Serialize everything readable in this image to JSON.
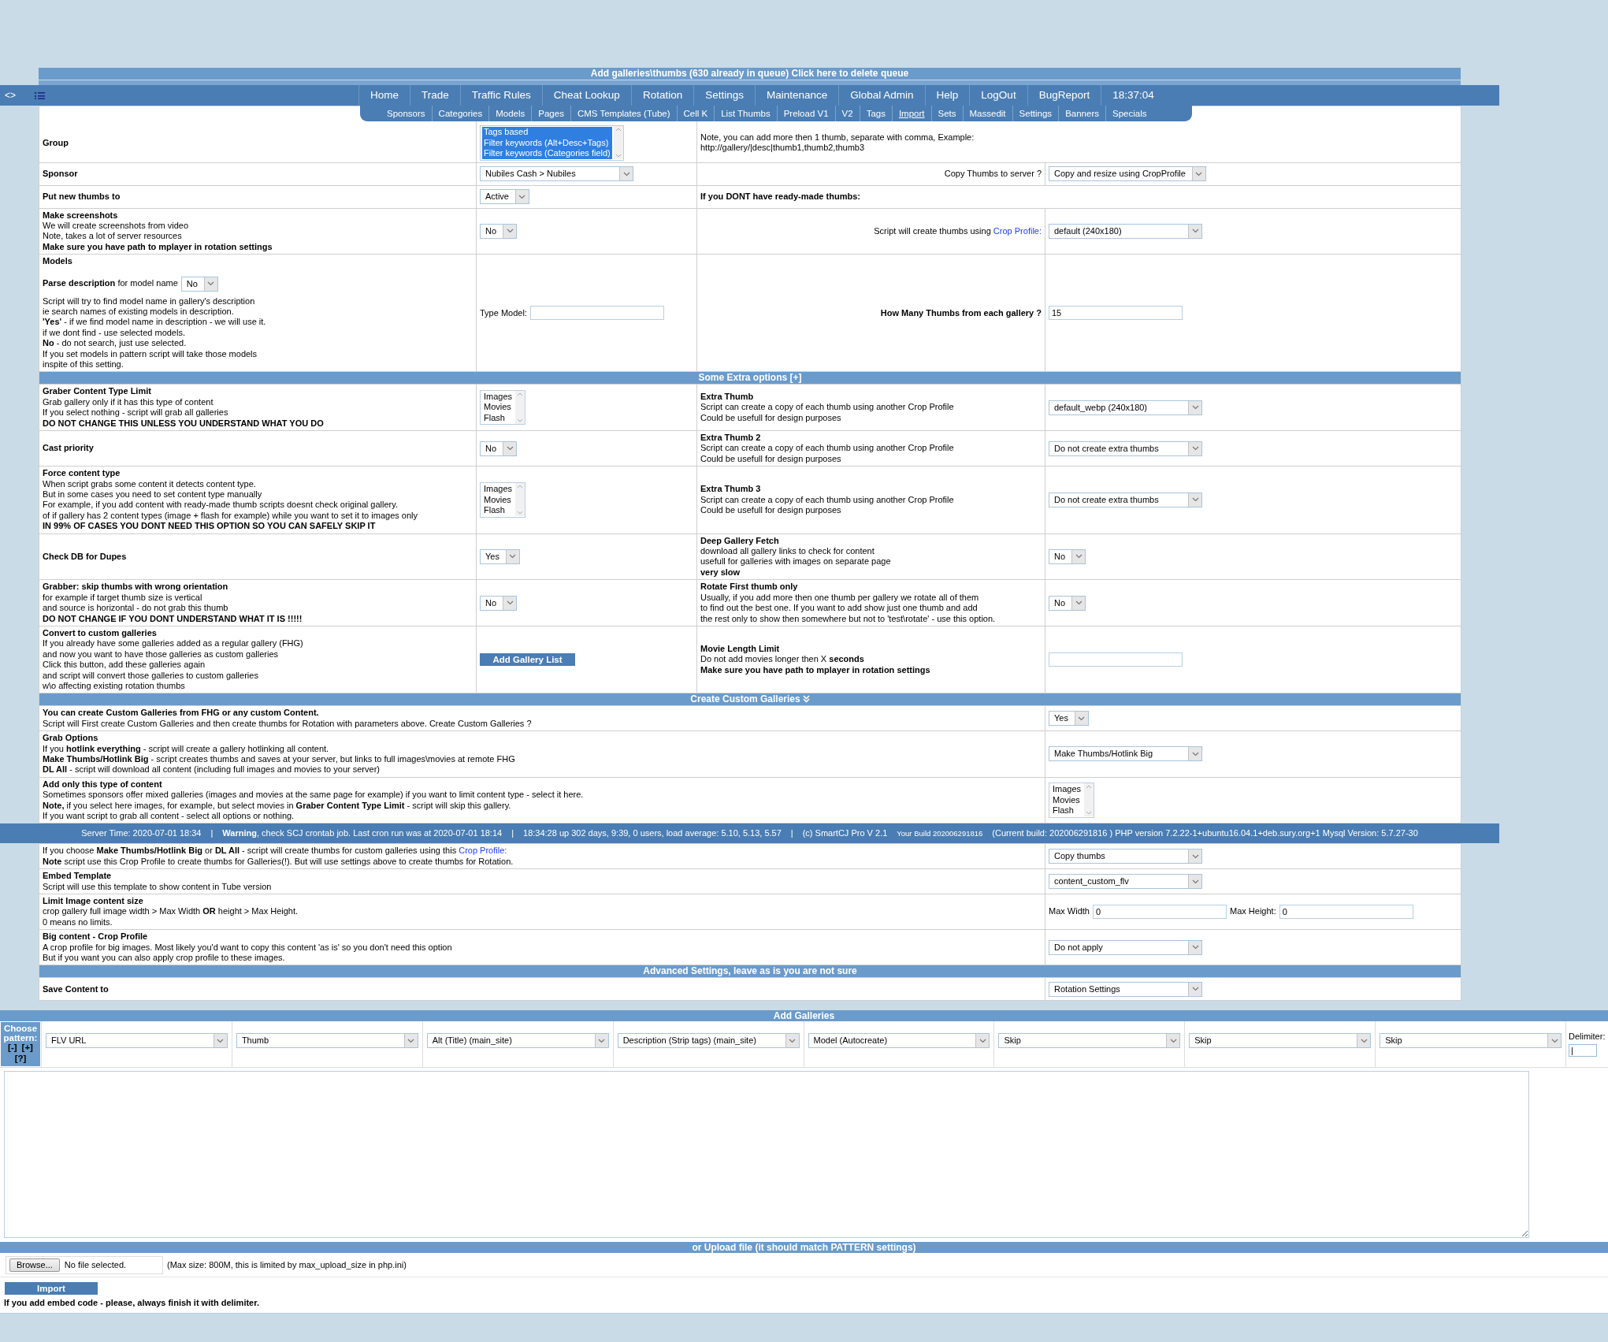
{
  "title_bar": {
    "text": "Add galleries\\thumbs (630 already in queue) Click here to delete queue"
  },
  "nav": {
    "toggle": "<>",
    "items": [
      {
        "label": "Home"
      },
      {
        "label": "Trade"
      },
      {
        "label": "Traffic Rules"
      },
      {
        "label": "Cheat Lookup"
      },
      {
        "label": "Rotation"
      },
      {
        "label": "Settings"
      },
      {
        "label": "Maintenance"
      },
      {
        "label": "Global Admin"
      },
      {
        "label": "Help"
      },
      {
        "label": "LogOut"
      },
      {
        "label": "BugReport"
      }
    ],
    "clock": "18:37:04"
  },
  "subnav": [
    {
      "label": "Sponsors",
      "selected": false
    },
    {
      "label": "Categories",
      "selected": false
    },
    {
      "label": "Models",
      "selected": false
    },
    {
      "label": "Pages",
      "selected": false
    },
    {
      "label": "CMS Templates (Tube)",
      "selected": false
    },
    {
      "label": "Cell K",
      "selected": false
    },
    {
      "label": "List Thumbs",
      "selected": false
    },
    {
      "label": "Preload V1",
      "selected": false
    },
    {
      "label": "V2",
      "selected": false
    },
    {
      "label": "Tags",
      "selected": false
    },
    {
      "label": "Import",
      "selected": true
    },
    {
      "label": "Sets",
      "selected": false
    },
    {
      "label": "Massedit",
      "selected": false
    },
    {
      "label": "Settings",
      "selected": false
    },
    {
      "label": "Banners",
      "selected": false
    },
    {
      "label": "Specials",
      "selected": false
    }
  ],
  "main_table": {
    "rows": [
      {
        "kind": "split",
        "cells": [
          [
            {
              "kind": "title",
              "text": "Group"
            }
          ],
          [
            {
              "kind": "listbox",
              "options": [
                {
                  "label": "Tags based",
                  "selected": true
                },
                {
                  "label": "Filter keywords (Alt+Desc+Tags)",
                  "selected": true
                },
                {
                  "label": "Filter keywords (Categories field)",
                  "selected": true
                }
              ]
            }
          ],
          [
            {
              "kind": "text",
              "text": "Note, you can add more then 1 thumb, separate with comma, Example:"
            },
            {
              "kind": "text",
              "text": "http://gallery/|desc|thumb1,thumb2,thumb3"
            }
          ]
        ]
      },
      {
        "kind": "four",
        "cells": [
          [
            {
              "kind": "title",
              "text": "Sponsor"
            }
          ],
          [
            {
              "kind": "select",
              "value": "Nubiles Cash > Nubiles"
            }
          ],
          [
            {
              "kind": "prompt",
              "text": "Copy Thumbs to server ?"
            }
          ],
          [
            {
              "kind": "select",
              "value": "Copy and resize using CropProfile"
            }
          ]
        ]
      },
      {
        "kind": "split",
        "cells": [
          [
            {
              "kind": "title",
              "text": "Put new thumbs to"
            }
          ],
          [
            {
              "kind": "select",
              "value": "Active"
            }
          ],
          [
            {
              "kind": "title",
              "text": "If you DONT have ready-made thumbs:"
            }
          ]
        ]
      },
      {
        "kind": "four",
        "cells": [
          [
            {
              "kind": "title",
              "text": "Make screenshots"
            },
            {
              "kind": "text",
              "text": "We will create screenshots from video"
            },
            {
              "kind": "text",
              "text": "Note, takes a lot of server resources"
            },
            {
              "kind": "title",
              "text": "Make sure you have path to mplayer in rotation settings"
            }
          ],
          [
            {
              "kind": "select",
              "value": "No"
            }
          ],
          [
            {
              "kind": "prompt",
              "text": "Script will create thumbs using",
              "link": "Crop Profile:"
            }
          ],
          [
            {
              "kind": "select",
              "value": "default (240x180)"
            }
          ]
        ]
      },
      {
        "kind": "four",
        "cells": [
          [
            {
              "kind": "title",
              "text": "Models"
            },
            {
              "kind": "inline-select",
              "text": "**Parse description** for model name",
              "value": "No"
            },
            {
              "kind": "text",
              "text": "Script will try to find model name in gallery's description"
            },
            {
              "kind": "text",
              "text": "ie search names of existing models in description."
            },
            {
              "kind": "text",
              "text": "**'Yes'** - if we find model name in description - we will use it."
            },
            {
              "kind": "text",
              "text": "if we dont find - use selected models."
            },
            {
              "kind": "text",
              "text": "**No** - do not search, just use selected."
            },
            {
              "kind": "text",
              "text": "If you set models in pattern script will take those models"
            },
            {
              "kind": "text",
              "text": "inspite of this setting."
            }
          ],
          [
            {
              "kind": "input",
              "label": "Type Model:"
            }
          ],
          [
            {
              "kind": "prompt",
              "text": "How Many Thumbs from each gallery ?",
              "bold": true
            }
          ],
          [
            {
              "kind": "input",
              "value": "15"
            }
          ]
        ]
      },
      {
        "kind": "section",
        "text": "Some Extra options [+]"
      },
      {
        "kind": "four",
        "cells": [
          [
            {
              "kind": "title",
              "text": "Graber Content Type Limit"
            },
            {
              "kind": "text",
              "text": "Grab gallery only if it has this type of content"
            },
            {
              "kind": "text",
              "text": "If you select nothing - script will grab all galleries"
            },
            {
              "kind": "title",
              "text": "DO NOT CHANGE THIS UNLESS YOU UNDERSTAND WHAT YOU DO"
            }
          ],
          [
            {
              "kind": "listbox",
              "options": [
                {
                  "label": "Images",
                  "selected": false
                },
                {
                  "label": "Movies",
                  "selected": false
                },
                {
                  "label": "Flash",
                  "selected": false
                }
              ]
            }
          ],
          [
            {
              "kind": "title",
              "text": "Extra Thumb"
            },
            {
              "kind": "text",
              "text": "Script can create a copy of each thumb using another Crop Profile"
            },
            {
              "kind": "text",
              "text": "Could be usefull for design purposes"
            }
          ],
          [
            {
              "kind": "select",
              "value": "default_webp (240x180)"
            }
          ]
        ]
      },
      {
        "kind": "four",
        "cells": [
          [
            {
              "kind": "title",
              "text": "Cast priority"
            }
          ],
          [
            {
              "kind": "select",
              "value": "No"
            }
          ],
          [
            {
              "kind": "title",
              "text": "Extra Thumb 2"
            },
            {
              "kind": "text",
              "text": "Script can create a copy of each thumb using another Crop Profile"
            },
            {
              "kind": "text",
              "text": "Could be usefull for design purposes"
            }
          ],
          [
            {
              "kind": "select",
              "value": "Do not create extra thumbs"
            }
          ]
        ]
      },
      {
        "kind": "four",
        "cells": [
          [
            {
              "kind": "title",
              "text": "Force content type"
            },
            {
              "kind": "text",
              "text": "When script grabs some content it detects content type."
            },
            {
              "kind": "text",
              "text": "But in some cases you need to set content type manually"
            },
            {
              "kind": "text",
              "text": "For example, if you add content with ready-made thumb scripts doesnt check original gallery."
            },
            {
              "kind": "text",
              "text": "of if gallery has 2 content types (image + flash for example) while you want to set it to images only"
            },
            {
              "kind": "title",
              "text": "IN 99% OF CASES YOU DONT NEED THIS OPTION SO YOU CAN SAFELY SKIP IT"
            }
          ],
          [
            {
              "kind": "listbox",
              "options": [
                {
                  "label": "Images",
                  "selected": false
                },
                {
                  "label": "Movies",
                  "selected": false
                },
                {
                  "label": "Flash",
                  "selected": false
                }
              ]
            }
          ],
          [
            {
              "kind": "title",
              "text": "Extra Thumb 3"
            },
            {
              "kind": "text",
              "text": "Script can create a copy of each thumb using another Crop Profile"
            },
            {
              "kind": "text",
              "text": "Could be usefull for design purposes"
            }
          ],
          [
            {
              "kind": "select",
              "value": "Do not create extra thumbs"
            }
          ]
        ]
      },
      {
        "kind": "four",
        "cells": [
          [
            {
              "kind": "title",
              "text": "Check DB for Dupes"
            }
          ],
          [
            {
              "kind": "select",
              "value": "Yes"
            }
          ],
          [
            {
              "kind": "title",
              "text": "Deep Gallery Fetch"
            },
            {
              "kind": "text",
              "text": "download all gallery links to check for content"
            },
            {
              "kind": "text",
              "text": "usefull for galleries with images on separate page"
            },
            {
              "kind": "title",
              "text": "very slow"
            }
          ],
          [
            {
              "kind": "select",
              "value": "No"
            }
          ]
        ]
      },
      {
        "kind": "four",
        "cells": [
          [
            {
              "kind": "title",
              "text": "Grabber: skip thumbs with wrong orientation"
            },
            {
              "kind": "text",
              "text": "for example if target thumb size is vertical"
            },
            {
              "kind": "text",
              "text": "and source is horizontal - do not grab this thumb"
            },
            {
              "kind": "title",
              "text": "DO NOT CHANGE IF YOU DONT UNDERSTAND WHAT IT IS !!!!!"
            }
          ],
          [
            {
              "kind": "select",
              "value": "No"
            }
          ],
          [
            {
              "kind": "title",
              "text": "Rotate First thumb only"
            },
            {
              "kind": "text",
              "text": "Usually, if you add more then one thumb per gallery we rotate all of them"
            },
            {
              "kind": "text",
              "text": "to find out the best one. If you want to add show just one thumb and add"
            },
            {
              "kind": "text",
              "text": "the rest only to show then somewhere but not to 'test\\rotate' - use this option."
            }
          ],
          [
            {
              "kind": "select",
              "value": "No"
            }
          ]
        ]
      },
      {
        "kind": "four",
        "cells": [
          [
            {
              "kind": "title",
              "text": "Convert to custom galleries"
            },
            {
              "kind": "text",
              "text": "If you already have some galleries added as a regular gallery (FHG)"
            },
            {
              "kind": "text",
              "text": "and now you want to have those galleries as custom galleries"
            },
            {
              "kind": "text",
              "text": "Click this button, add these galleries again"
            },
            {
              "kind": "text",
              "text": "and script will convert those galleries to custom galleries"
            },
            {
              "kind": "text",
              "text": "w\\o affecting existing rotation thumbs"
            }
          ],
          [
            {
              "kind": "button",
              "label": "Add Gallery List"
            }
          ],
          [
            {
              "kind": "title",
              "text": "Movie Length Limit"
            },
            {
              "kind": "text",
              "text": "Do not add movies longer then X **seconds**"
            },
            {
              "kind": "title",
              "text": "Make sure you have path to mplayer in rotation settings"
            }
          ],
          [
            {
              "kind": "input"
            }
          ]
        ]
      },
      {
        "kind": "section-toggle",
        "text": "Create Custom Galleries"
      },
      {
        "kind": "wide",
        "cells": [
          [
            {
              "kind": "title",
              "text": "You can create Custom Galleries from FHG or any custom Content."
            },
            {
              "kind": "text",
              "text": "Script will First create Custom Galleries and then create thumbs for Rotation with parameters above. Create Custom Galleries ?"
            }
          ],
          [
            {
              "kind": "select",
              "value": "Yes"
            }
          ]
        ]
      },
      {
        "kind": "wide",
        "cells": [
          [
            {
              "kind": "title",
              "text": "Grab Options"
            },
            {
              "kind": "text",
              "text": "If you **hotlink everything** - script will create a gallery hotlinking all content."
            },
            {
              "kind": "text",
              "text": "**Make Thumbs/Hotlink Big** - script creates thumbs and saves at your server, but links to full images\\movies at remote FHG"
            },
            {
              "kind": "text",
              "text": "**DL All** - script will download all content (including full images and movies to your server)"
            }
          ],
          [
            {
              "kind": "select",
              "value": "Make Thumbs/Hotlink Big"
            }
          ]
        ]
      },
      {
        "kind": "wide",
        "cells": [
          [
            {
              "kind": "title",
              "text": "Add only this type of content"
            },
            {
              "kind": "text",
              "text": "Sometimes sponsors offer mixed galleries (images and movies at the same page for example) if you want to limit content type - select it here."
            },
            {
              "kind": "text",
              "text": "**Note,** if you select here images, for example, but select movies in **Graber Content Type Limit** - script will skip this gallery."
            },
            {
              "kind": "text",
              "text": "If you want script to grab all content - select all options or nothing."
            }
          ],
          [
            {
              "kind": "listbox",
              "options": [
                {
                  "label": "Images",
                  "selected": false
                },
                {
                  "label": "Movies",
                  "selected": false
                },
                {
                  "label": "Flash",
                  "selected": false
                }
              ]
            }
          ]
        ]
      }
    ]
  },
  "status_bar": {
    "segments": [
      {
        "kind": "text",
        "text": "Server Time: 2020-07-01 18:34"
      },
      {
        "kind": "sep",
        "text": "|"
      },
      {
        "kind": "text",
        "text": "**Warning**, check SCJ crontab job. Last cron run was at",
        "link": "2020-07-01 18:14"
      },
      {
        "kind": "sep",
        "text": "|"
      },
      {
        "kind": "text",
        "text": "18:34:28 up 302 days, 9:39, 0 users, load average: 5.10, 5.13, 5.57"
      },
      {
        "kind": "sep",
        "text": "|"
      },
      {
        "kind": "text",
        "text": "(c)",
        "link": "SmartCJ Pro",
        "after": "V 2.1"
      },
      {
        "kind": "small",
        "text": "Your Build 202006291816"
      },
      {
        "kind": "text",
        "text": "(Current build: 202006291816 ) PHP version 7.2.22-1+ubuntu16.04.1+deb.sury.org+1 Mysql Version: 5.7.27-30"
      }
    ]
  },
  "lower_table": {
    "rows": [
      {
        "kind": "wide",
        "cells": [
          [
            {
              "kind": "text",
              "text": "If you choose **Make Thumbs/Hotlink Big** or **DL All** - script will create thumbs for custom galleries using this",
              "link": "Crop Profile:"
            },
            {
              "kind": "text",
              "text": "**Note** script use this Crop Profile to create thumbs for Galleries(!). But will use settings above to create thumbs for Rotation."
            }
          ],
          [
            {
              "kind": "select",
              "value": "Copy thumbs"
            }
          ]
        ]
      },
      {
        "kind": "wide",
        "cells": [
          [
            {
              "kind": "title",
              "text": "Embed Template"
            },
            {
              "kind": "text",
              "text": "Script will use this template to show content in Tube version"
            }
          ],
          [
            {
              "kind": "select",
              "value": "content_custom_flv"
            }
          ]
        ]
      },
      {
        "kind": "wide",
        "cells": [
          [
            {
              "kind": "title",
              "text": "Limit Image content size"
            },
            {
              "kind": "text",
              "text": "crop gallery full image width > Max Width **OR** height > Max Height."
            },
            {
              "kind": "text",
              "text": "0 means no limits."
            }
          ],
          [
            {
              "kind": "input-row",
              "fields": [
                {
                  "label": "Max Width",
                  "value": "0"
                },
                {
                  "label": "Max Height:",
                  "value": "0"
                }
              ]
            }
          ]
        ]
      },
      {
        "kind": "wide",
        "cells": [
          [
            {
              "kind": "title",
              "text": "Big content - Crop Profile"
            },
            {
              "kind": "text",
              "text": "A crop profile for big images. Most likely you'd want to copy this content 'as is' so you don't need this option"
            },
            {
              "kind": "text",
              "text": "But if you want you can also apply crop profile to these images."
            }
          ],
          [
            {
              "kind": "select",
              "value": "Do not apply"
            }
          ]
        ]
      },
      {
        "kind": "section",
        "text": "Advanced Settings, leave as is you are not sure"
      },
      {
        "kind": "wide",
        "cells": [
          [
            {
              "kind": "title",
              "text": "Save Content to"
            }
          ],
          [
            {
              "kind": "select",
              "value": "Rotation Settings"
            }
          ]
        ]
      }
    ]
  },
  "add_galleries": {
    "header": "Add Galleries",
    "pattern_label": "Choose pattern:",
    "pattern_links": [
      "[-]",
      "[+]",
      "[?]"
    ],
    "fields": [
      "FLV URL",
      "Thumb",
      "Alt (Title) (main_site)",
      "Description (Strip tags) (main_site)",
      "Model (Autocreate)",
      "Skip",
      "Skip",
      "Skip"
    ],
    "delimiter": {
      "label": "Delimiter:",
      "value": "|"
    },
    "upload_header": "or Upload file (it should match PATTERN settings)",
    "browse": "Browse...",
    "file_status": "No file selected.",
    "upload_note": "(Max size: 800M, this is limited by max_upload_size in php.ini)",
    "import": "Import",
    "footer": "If you add embed code - please, always finish it with delimiter."
  }
}
